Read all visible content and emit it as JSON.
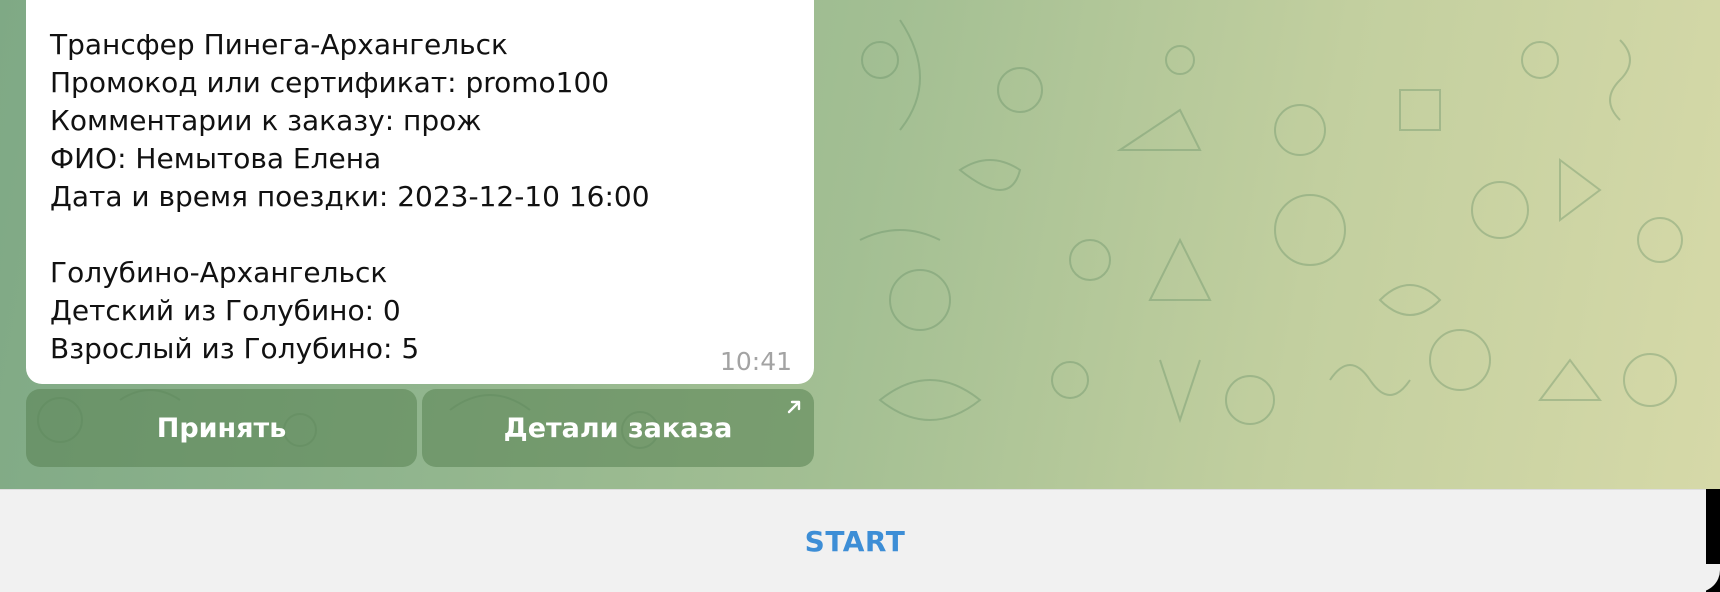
{
  "message": {
    "lines": [
      "Трансфер Пинега-Архангельск",
      "Промокод или сертификат: promo100",
      "Комментарии к заказу: прож",
      "ФИО: Немытова Елена",
      "Дата и время поездки: 2023-12-10 16:00",
      "",
      "Голубино-Архангельск",
      "Детский из Голубино: 0",
      "Взрослый из Голубино: 5"
    ],
    "time": "10:41"
  },
  "keyboard": {
    "accept_label": "Принять",
    "details_label": "Детали заказа",
    "details_icon": "external-link-arrow-icon"
  },
  "bottom": {
    "start_label": "START"
  },
  "colors": {
    "accent": "#3d8ed6",
    "bubble": "#ffffff",
    "bottom_bar": "#f1f1f1"
  }
}
